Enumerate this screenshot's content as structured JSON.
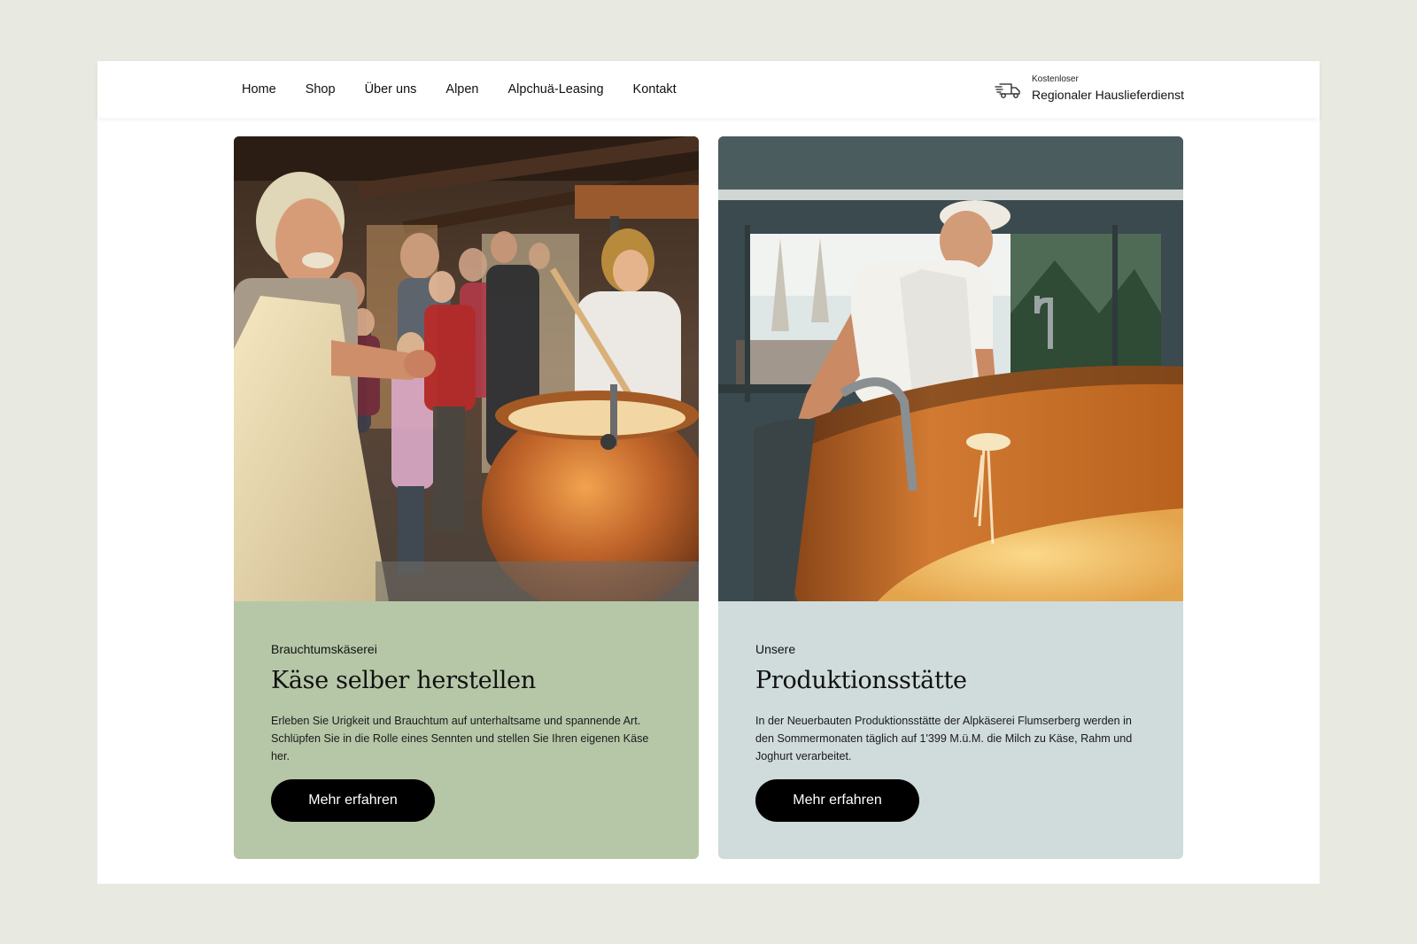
{
  "nav": {
    "items": [
      {
        "label": "Home"
      },
      {
        "label": "Shop"
      },
      {
        "label": "Über uns"
      },
      {
        "label": "Alpen"
      },
      {
        "label": "Alpchuä-Leasing"
      },
      {
        "label": "Kontakt"
      }
    ],
    "delivery": {
      "icon": "delivery-truck-icon",
      "small": "Kostenloser",
      "big": "Regionaler Hauslieferdienst"
    }
  },
  "cards": [
    {
      "image": "cheesemaker-with-copper-kettle-and-visitors-photo",
      "eyebrow": "Brauchtumskäserei",
      "title": "Käse selber herstellen",
      "text": "Erleben Sie Urigkeit und Brauchtum auf unterhaltsame und spannende Art. Schlüpfen Sie in die Rolle eines Sennten und stellen Sie Ihren eigenen Käse her.",
      "button": "Mehr erfahren",
      "panel_color": "#b6c7a7"
    },
    {
      "image": "cheesemaker-at-copper-vat-photo",
      "eyebrow": "Unsere",
      "title": "Produktionsstätte",
      "text": "In der Neuerbauten Produktionsstätte der Alpkäserei Flumserberg werden in den Sommermonaten täglich auf 1'399 M.ü.M. die Milch zu Käse, Rahm und Joghurt verarbeitet.",
      "button": "Mehr erfahren",
      "panel_color": "#d0dbdb"
    }
  ],
  "colors": {
    "background": "#e8eae1",
    "button": "#000000"
  }
}
